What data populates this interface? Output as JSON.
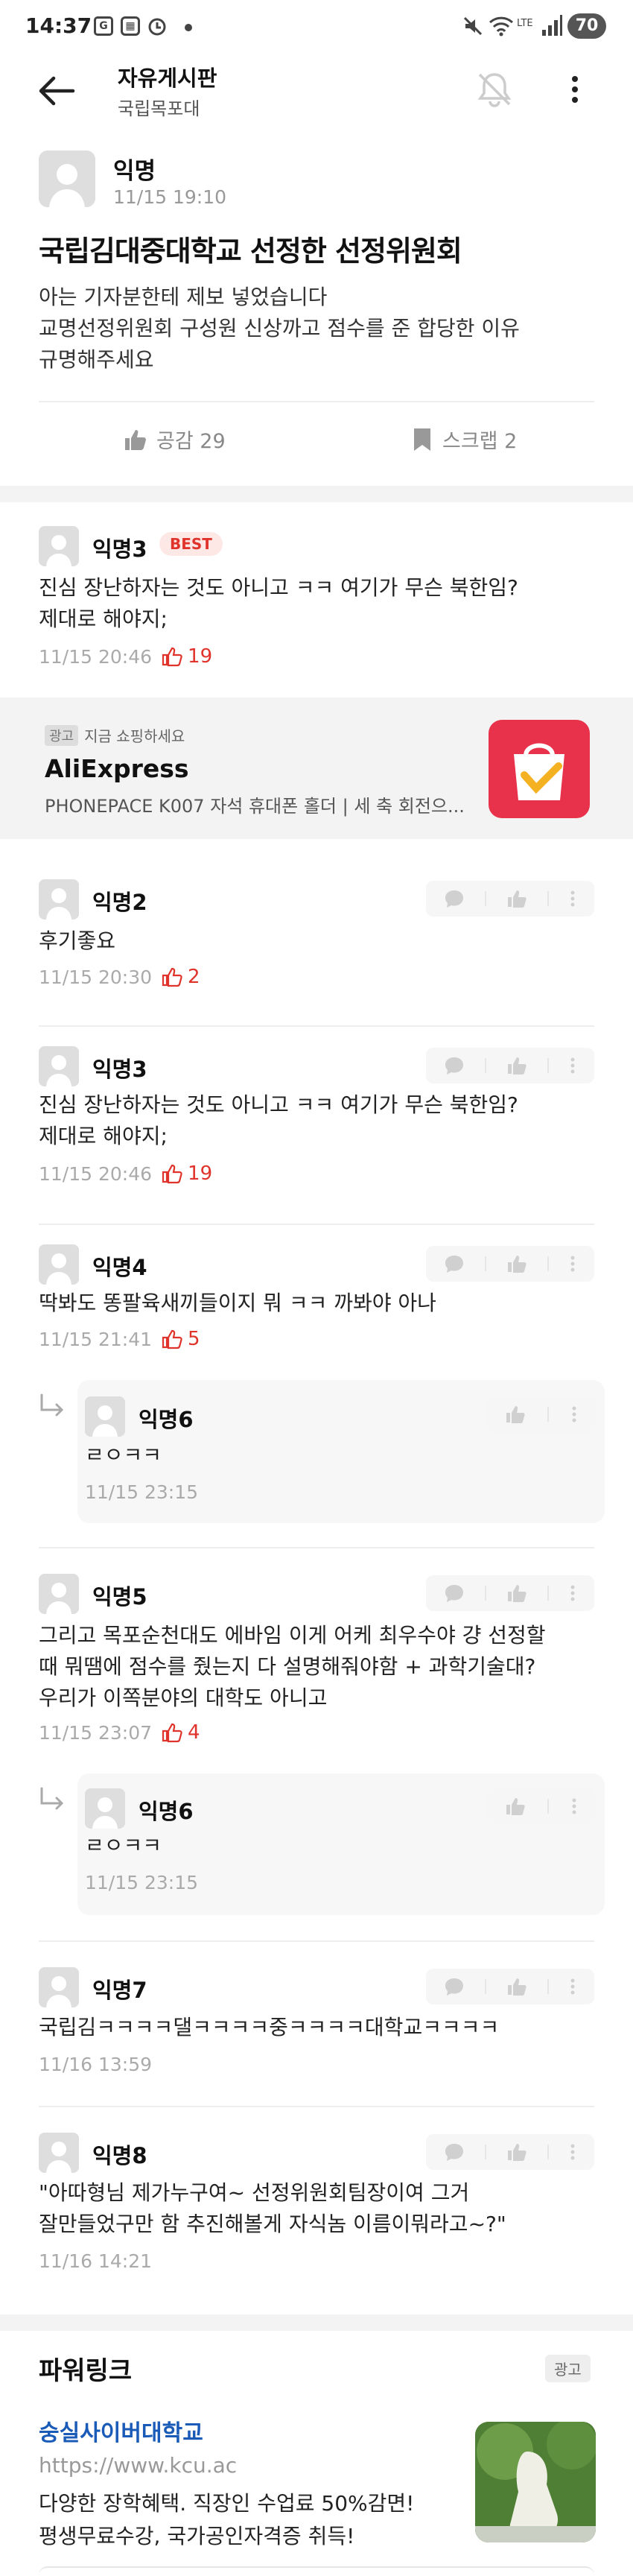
{
  "status": {
    "time": "14:37",
    "battery": "70"
  },
  "appbar": {
    "title": "자유게시판",
    "subtitle": "국립목포대"
  },
  "post": {
    "author": "익명",
    "date": "11/15 19:10",
    "title": "국립김대중대학교 선정한 선정위원회",
    "body_lines": [
      "아는 기자분한테 제보 넣었습니다",
      "교명선정위원회 구성원 신상까고 점수를 준 합당한 이유",
      "규명해주세요"
    ],
    "like_label": "공감 29",
    "scrap_label": "스크랩 2"
  },
  "best_comment": {
    "author": "익명3",
    "badge": "BEST",
    "lines": [
      "진심 장난하자는 것도 아니고 ㅋㅋ 여기가 무슨 북한임?",
      "제대로 해야지;"
    ],
    "date": "11/15 20:46",
    "likes": "19"
  },
  "ad": {
    "label": "광고",
    "top_text": "지금 쇼핑하세요",
    "title": "AliExpress",
    "desc": "PHONEPACE K007 자석 휴대폰 홀더 | 세 축 회전으..."
  },
  "comments": [
    {
      "author": "익명2",
      "lines": [
        "후기좋요"
      ],
      "date": "11/15 20:30",
      "likes": "2"
    },
    {
      "author": "익명3",
      "lines": [
        "진심 장난하자는 것도 아니고 ㅋㅋ 여기가 무슨 북한임?",
        "제대로 해야지;"
      ],
      "date": "11/15 20:46",
      "likes": "19"
    },
    {
      "author": "익명4",
      "lines": [
        "딱봐도 똥팔육새끼들이지 뭐 ㅋㅋ 까봐야 아나"
      ],
      "date": "11/15 21:41",
      "likes": "5"
    },
    {
      "author": "익명5",
      "lines": [
        "그리고 목포순천대도 에바임 이게 어케 최우수야 걍 선정할",
        "때 뭐땜에 점수를 줬는지 다 설명해줘야함   + 과학기술대?",
        "우리가 이쪽분야의 대학도 아니고"
      ],
      "date": "11/15 23:07",
      "likes": "4"
    },
    {
      "author": "익명7",
      "lines": [
        "국립김ㅋㅋㅋㅋ댈ㅋㅋㅋㅋ중ㅋㅋㅋㅋ대학교ㅋㅋㅋㅋ"
      ],
      "date": "11/16 13:59"
    },
    {
      "author": "익명8",
      "lines": [
        "\"아따형님 제가누구여~ 선정위원회팀장이여 그거",
        "잘만들었구만 함 추진해볼게 자식놈 이름이뭐라고~?\""
      ],
      "date": "11/16 14:21"
    }
  ],
  "replies": [
    {
      "author": "익명6",
      "text": "ㄹㅇㅋㅋ",
      "date": "11/15 23:15"
    },
    {
      "author": "익명6",
      "text": "ㄹㅇㅋㅋ",
      "date": "11/15 23:15"
    }
  ],
  "powerlink": {
    "title": "파워링크",
    "badge": "광고",
    "name": "숭실사이버대학교",
    "url": "https://www.kcu.ac",
    "desc_lines": [
      "다양한 장학혜택. 직장인 수업료 50%감면!",
      "평생무료수강, 국가공인자격증 취득!"
    ]
  },
  "colors": {
    "accent_red": "#e0332b",
    "link_blue": "#1b5bb8",
    "gray_band": "#f3f3f3"
  }
}
